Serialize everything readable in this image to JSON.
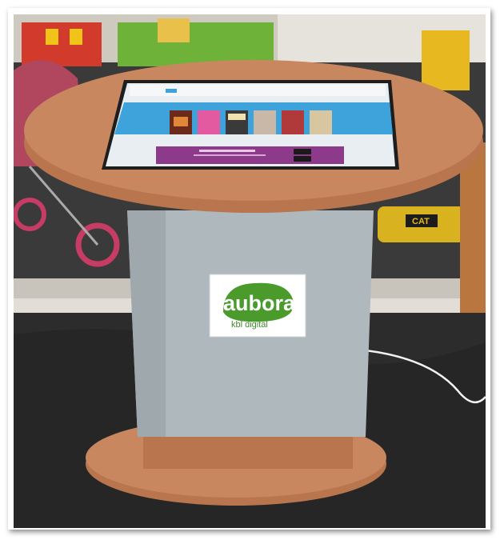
{
  "kiosk": {
    "logo_text": "aubora",
    "logo_subtext": "kbl digital"
  },
  "colors": {
    "tabletop": "#c8875e",
    "tabletop_edge": "#b8754e",
    "pedestal": "#aeb8bd",
    "floor": "#2c2c2c",
    "screen_blue": "#3fa3db",
    "screen_purple": "#8d3a8a",
    "logo_green": "#4a9a2c"
  },
  "signs": {
    "cat_label": "CAT"
  }
}
